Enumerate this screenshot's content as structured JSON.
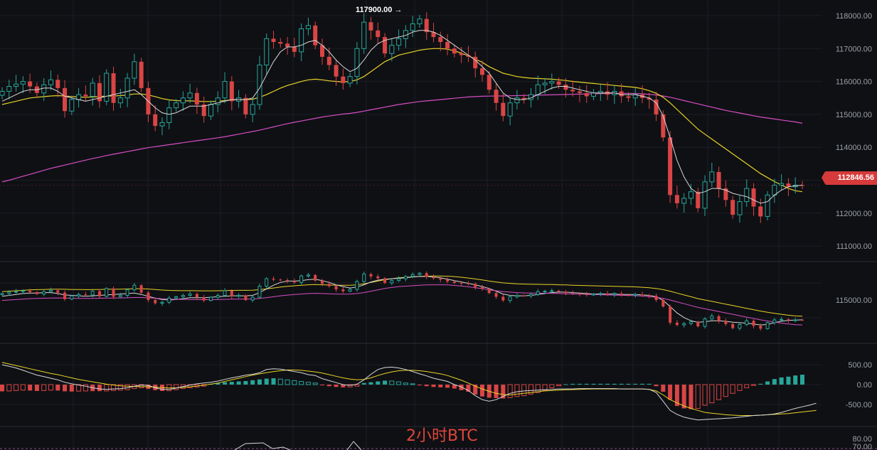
{
  "chart_data": {
    "type": "candlestick",
    "caption": "2小时BTC",
    "current_price_label": "112846.56",
    "peak_annotation": "117900.00 →",
    "price_axis": {
      "ylim": [
        110400,
        118250
      ],
      "ticks": [
        "118000.00",
        "117000.00",
        "116000.00",
        "115000.00",
        "114000.00",
        "113000.00",
        "112000.00",
        "111000.00"
      ],
      "tick_values": [
        118000,
        117000,
        116000,
        115000,
        114000,
        113000,
        112000,
        111000
      ]
    },
    "sub_axis": {
      "ticks": [
        "115000.00"
      ],
      "tick_values": [
        115000
      ]
    },
    "macd_axis": {
      "ylim": [
        -1000,
        750
      ],
      "ticks": [
        "500.00",
        "0.00",
        "-500.00"
      ],
      "tick_values": [
        500,
        0,
        -500
      ]
    },
    "rsi_axis": {
      "ticks": [
        "80.00",
        "70.00"
      ],
      "tick_values": [
        80,
        70
      ]
    },
    "colors": {
      "up": "#26a69a",
      "down": "#d94545",
      "ma_short": "#d8d8d8",
      "ma_mid": "#e8d327",
      "ma_long": "#d64ec4"
    },
    "closes": [
      115700,
      115850,
      115920,
      116000,
      115850,
      115650,
      115900,
      116050,
      115800,
      115100,
      115450,
      115600,
      115550,
      115950,
      115400,
      116250,
      115350,
      115500,
      116100,
      116600,
      115800,
      115000,
      114650,
      114750,
      115200,
      115350,
      115500,
      115650,
      115300,
      114950,
      115300,
      115500,
      116000,
      115400,
      115500,
      115000,
      115300,
      116500,
      117300,
      117200,
      117150,
      117050,
      116900,
      117600,
      117700,
      117100,
      116750,
      116500,
      116150,
      115950,
      116150,
      117000,
      117800,
      117550,
      117350,
      116850,
      117100,
      117300,
      117550,
      117750,
      117900,
      117500,
      117350,
      117200,
      117000,
      116850,
      116800,
      116750,
      116400,
      116200,
      115750,
      115350,
      114950,
      115350,
      115500,
      115450,
      115600,
      115900,
      115950,
      116000,
      115900,
      115750,
      115700,
      115650,
      115550,
      115650,
      115700,
      115600,
      115700,
      115550,
      115500,
      115600,
      115500,
      115450,
      115000,
      114300,
      112550,
      112300,
      112450,
      112650,
      112150,
      112950,
      113250,
      112750,
      112400,
      111950,
      112350,
      112750,
      112200,
      111900,
      112550,
      112850,
      112900,
      112800,
      112850,
      112846
    ],
    "ma_short": [
      115400,
      115500,
      115600,
      115700,
      115750,
      115750,
      115800,
      115800,
      115700,
      115550,
      115500,
      115450,
      115400,
      115450,
      115500,
      115550,
      115600,
      115650,
      115700,
      115750,
      115600,
      115400,
      115200,
      115050,
      115000,
      115050,
      115150,
      115250,
      115250,
      115250,
      115300,
      115350,
      115400,
      115450,
      115450,
      115450,
      115500,
      115800,
      116200,
      116600,
      116900,
      117050,
      117050,
      117100,
      117200,
      117250,
      117100,
      116900,
      116650,
      116450,
      116300,
      116400,
      116650,
      116950,
      117150,
      117250,
      117300,
      117350,
      117400,
      117500,
      117550,
      117550,
      117500,
      117400,
      117250,
      117100,
      116950,
      116800,
      116650,
      116450,
      116250,
      115950,
      115650,
      115500,
      115450,
      115450,
      115500,
      115600,
      115700,
      115800,
      115850,
      115850,
      115800,
      115750,
      115700,
      115650,
      115650,
      115650,
      115650,
      115600,
      115600,
      115600,
      115550,
      115500,
      115350,
      114950,
      114300,
      113600,
      113100,
      112750,
      112600,
      112650,
      112750,
      112750,
      112700,
      112600,
      112550,
      112500,
      112400,
      112300,
      112350,
      112550,
      112700,
      112800,
      112830,
      112850
    ],
    "ma_mid": [
      115300,
      115350,
      115400,
      115450,
      115500,
      115520,
      115540,
      115560,
      115570,
      115560,
      115540,
      115530,
      115520,
      115530,
      115540,
      115560,
      115560,
      115570,
      115590,
      115620,
      115620,
      115590,
      115540,
      115480,
      115440,
      115420,
      115410,
      115410,
      115400,
      115390,
      115390,
      115400,
      115420,
      115440,
      115450,
      115450,
      115460,
      115520,
      115600,
      115700,
      115800,
      115880,
      115940,
      116000,
      116050,
      116070,
      116050,
      116020,
      116000,
      115990,
      116000,
      116050,
      116150,
      116300,
      116450,
      116600,
      116700,
      116800,
      116850,
      116900,
      116950,
      116980,
      117000,
      117000,
      116980,
      116930,
      116860,
      116780,
      116680,
      116580,
      116450,
      116350,
      116250,
      116200,
      116150,
      116120,
      116100,
      116090,
      116080,
      116070,
      116050,
      116030,
      116000,
      115980,
      115960,
      115940,
      115920,
      115900,
      115880,
      115860,
      115840,
      115820,
      115780,
      115720,
      115640,
      115520,
      115350,
      115150,
      114950,
      114750,
      114550,
      114400,
      114250,
      114100,
      113950,
      113800,
      113650,
      113500,
      113350,
      113200,
      113080,
      112960,
      112850,
      112750,
      112680,
      112650
    ],
    "ma_long": [
      112950,
      113000,
      113060,
      113120,
      113180,
      113240,
      113300,
      113360,
      113410,
      113460,
      113510,
      113560,
      113610,
      113660,
      113700,
      113750,
      113790,
      113830,
      113870,
      113910,
      113950,
      113990,
      114020,
      114050,
      114080,
      114110,
      114140,
      114170,
      114200,
      114230,
      114260,
      114290,
      114320,
      114360,
      114400,
      114440,
      114480,
      114520,
      114570,
      114620,
      114670,
      114720,
      114760,
      114800,
      114840,
      114880,
      114920,
      114950,
      114980,
      115010,
      115030,
      115060,
      115100,
      115140,
      115180,
      115220,
      115260,
      115300,
      115330,
      115360,
      115390,
      115410,
      115430,
      115450,
      115470,
      115490,
      115510,
      115530,
      115540,
      115550,
      115555,
      115560,
      115560,
      115565,
      115570,
      115575,
      115580,
      115585,
      115590,
      115595,
      115600,
      115605,
      115610,
      115615,
      115620,
      115625,
      115630,
      115635,
      115640,
      115640,
      115640,
      115635,
      115625,
      115610,
      115590,
      115560,
      115520,
      115470,
      115420,
      115370,
      115320,
      115270,
      115220,
      115170,
      115120,
      115080,
      115040,
      115000,
      114960,
      114920,
      114890,
      114860,
      114830,
      114800,
      114770,
      114730
    ],
    "macd_hist": [
      -170,
      -160,
      -150,
      -140,
      -150,
      -160,
      -150,
      -140,
      -150,
      -170,
      -175,
      -165,
      -160,
      -165,
      -165,
      -160,
      -150,
      -140,
      -130,
      -100,
      -80,
      -110,
      -140,
      -160,
      -155,
      -130,
      -100,
      -80,
      -60,
      -40,
      20,
      40,
      60,
      70,
      80,
      90,
      110,
      130,
      150,
      160,
      140,
      120,
      100,
      80,
      60,
      40,
      -20,
      -40,
      -60,
      -70,
      -60,
      -40,
      40,
      60,
      80,
      100,
      90,
      70,
      40,
      20,
      -20,
      -40,
      -60,
      -70,
      -80,
      -100,
      -140,
      -180,
      -250,
      -300,
      -330,
      -340,
      -350,
      -330,
      -300,
      -280,
      -240,
      -200,
      -140,
      -80,
      -30,
      10,
      20,
      20,
      20,
      20,
      20,
      20,
      20,
      20,
      20,
      20,
      20,
      20,
      -40,
      -180,
      -380,
      -540,
      -600,
      -620,
      -600,
      -520,
      -460,
      -380,
      -300,
      -220,
      -150,
      -80,
      -20,
      20,
      80,
      140,
      180,
      200,
      230,
      250
    ],
    "macd_line": [
      500,
      460,
      420,
      360,
      300,
      240,
      200,
      160,
      120,
      60,
      20,
      -10,
      -40,
      -80,
      -110,
      -120,
      -110,
      -100,
      -80,
      -40,
      -10,
      -20,
      -80,
      -120,
      -120,
      -90,
      -50,
      -10,
      20,
      40,
      60,
      90,
      130,
      170,
      200,
      240,
      260,
      300,
      380,
      400,
      390,
      360,
      330,
      300,
      250,
      230,
      150,
      100,
      50,
      0,
      -20,
      10,
      120,
      260,
      380,
      430,
      440,
      420,
      380,
      330,
      270,
      220,
      160,
      120,
      80,
      0,
      -60,
      -150,
      -280,
      -380,
      -420,
      -380,
      -300,
      -220,
      -180,
      -160,
      -150,
      -140,
      -130,
      -120,
      -110,
      -110,
      -110,
      -100,
      -100,
      -100,
      -100,
      -100,
      -100,
      -110,
      -110,
      -110,
      -110,
      -120,
      -200,
      -420,
      -650,
      -750,
      -820,
      -860,
      -890,
      -880,
      -870,
      -860,
      -850,
      -840,
      -820,
      -800,
      -780,
      -770,
      -760,
      -740,
      -700,
      -650,
      -600,
      -560,
      -520,
      -470
    ],
    "macd_signal": [
      560,
      520,
      480,
      440,
      400,
      360,
      320,
      280,
      250,
      210,
      170,
      130,
      100,
      70,
      40,
      10,
      -10,
      -30,
      -40,
      -50,
      -50,
      -55,
      -65,
      -75,
      -85,
      -80,
      -70,
      -55,
      -35,
      -15,
      10,
      40,
      80,
      120,
      160,
      200,
      240,
      270,
      300,
      330,
      350,
      370,
      370,
      360,
      340,
      320,
      290,
      250,
      210,
      170,
      140,
      120,
      130,
      170,
      230,
      280,
      320,
      350,
      360,
      360,
      350,
      330,
      300,
      270,
      230,
      170,
      110,
      40,
      -40,
      -110,
      -170,
      -220,
      -250,
      -260,
      -240,
      -220,
      -200,
      -180,
      -160,
      -150,
      -140,
      -130,
      -125,
      -120,
      -115,
      -110,
      -110,
      -110,
      -110,
      -110,
      -110,
      -110,
      -110,
      -120,
      -160,
      -260,
      -380,
      -460,
      -540,
      -600,
      -650,
      -700,
      -720,
      -740,
      -760,
      -770,
      -780,
      -780,
      -780,
      -770,
      -760,
      -750,
      -740,
      -730,
      -710,
      -690,
      -670,
      -650
    ]
  }
}
